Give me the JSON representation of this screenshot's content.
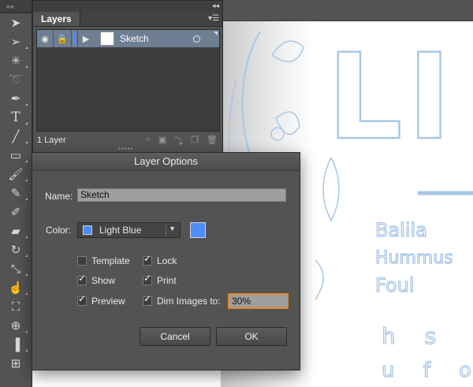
{
  "layers_panel": {
    "tab_label": "Layers",
    "layer": {
      "name": "Sketch",
      "color": "#4f8cff"
    },
    "count_label": "1 Layer"
  },
  "dialog": {
    "title": "Layer Options",
    "name_label": "Name:",
    "name_value": "Sketch",
    "color_label": "Color:",
    "color_value": "Light Blue",
    "color_hex": "#4f8cff",
    "checkboxes": {
      "template": {
        "label": "Template",
        "checked": false
      },
      "lock": {
        "label": "Lock",
        "checked": true
      },
      "show": {
        "label": "Show",
        "checked": true
      },
      "print": {
        "label": "Print",
        "checked": true
      },
      "preview": {
        "label": "Preview",
        "checked": true
      },
      "dim": {
        "label": "Dim Images to:",
        "checked": true
      }
    },
    "dim_value": "30%",
    "cancel_label": "Cancel",
    "ok_label": "OK"
  },
  "canvas_sketch": {
    "big_letters": "LI",
    "menu_lines": [
      "Balila",
      "Hummus",
      "Foul"
    ],
    "extra_letters": [
      "h s",
      "u f o"
    ]
  },
  "icons": [
    "selection-icon",
    "direct-selection-icon",
    "magic-wand-icon",
    "lasso-icon",
    "pen-icon",
    "type-icon",
    "line-icon",
    "rectangle-icon",
    "paintbrush-icon",
    "pencil-icon",
    "blob-brush-icon",
    "eraser-icon",
    "rotate-icon",
    "scale-icon",
    "warp-icon",
    "free-transform-icon",
    "shape-builder-icon",
    "graph-icon",
    "mesh-icon"
  ]
}
